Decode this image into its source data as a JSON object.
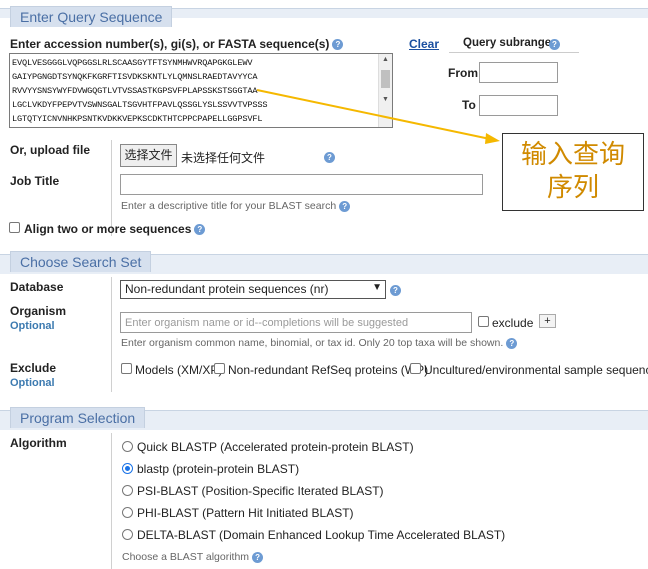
{
  "sections": {
    "query": "Enter Query Sequence",
    "search_set": "Choose Search Set",
    "program": "Program Selection"
  },
  "query": {
    "accession_label": "Enter accession number(s), gi(s), or FASTA sequence(s)",
    "clear_link": "Clear",
    "subrange_label": "Query subrange",
    "from_label": "From",
    "to_label": "To",
    "sequence_lines": [
      "EVQLVESGGGLVQPGGSLRLSCAASGYTFTSYNMHWVRQAPGKGLEWV",
      "GAIYPGNGDTSYNQKFKGRFTISVDKSKNTLYLQMNSLRAEDTAVYYCA",
      "RVVYYSNSYWYFDVWGQGTLVTVSSASTKGPSVFPLAPSSKSTSGGTAA",
      "LGCLVKDYFPEPVTVSWNSGALTSGVHTFPAVLQSSGLYSLSSVVTVPSSS",
      "LGTQTYICNVNHKPSNTKVDKKVEPKSCDKTHTCPPCPAPELLGGPSVFL"
    ],
    "upload_label": "Or, upload file",
    "file_button": "选择文件",
    "file_status": "未选择任何文件",
    "job_title_label": "Job Title",
    "job_title_hint": "Enter a descriptive title for your BLAST search",
    "align_label": "Align two or more sequences"
  },
  "callout": {
    "line1": "输入查询",
    "line2": "序列",
    "color": "#d08a00",
    "arrow_color": "#f5b800"
  },
  "search_set": {
    "database_label": "Database",
    "database_value": "Non-redundant protein sequences (nr)",
    "organism_label": "Organism",
    "optional_label": "Optional",
    "organism_placeholder": "Enter organism name or id--completions will be suggested",
    "exclude_label": "exclude",
    "add_button": "+",
    "organism_hint": "Enter organism common name, binomial, or tax id. Only 20 top taxa will be shown.",
    "exclude_section_label": "Exclude",
    "exclude_options": [
      "Models (XM/XP)",
      "Non-redundant RefSeq proteins (WP)",
      "Uncultured/environmental sample sequences"
    ]
  },
  "program": {
    "algorithm_label": "Algorithm",
    "algorithms": [
      "Quick BLASTP (Accelerated protein-protein BLAST)",
      "blastp (protein-protein BLAST)",
      "PSI-BLAST (Position-Specific Iterated BLAST)",
      "PHI-BLAST (Pattern Hit Initiated BLAST)",
      "DELTA-BLAST (Domain Enhanced Lookup Time Accelerated BLAST)"
    ],
    "selected_index": 1,
    "algorithm_hint": "Choose a BLAST algorithm"
  },
  "colors": {
    "section_band": "#e8eef6",
    "section_tab": "#d6e0ee",
    "tab_text": "#4a6fa5",
    "optional_text": "#3c7ab0",
    "link": "#1a4fa0",
    "help_icon": "#6d9bd3"
  }
}
